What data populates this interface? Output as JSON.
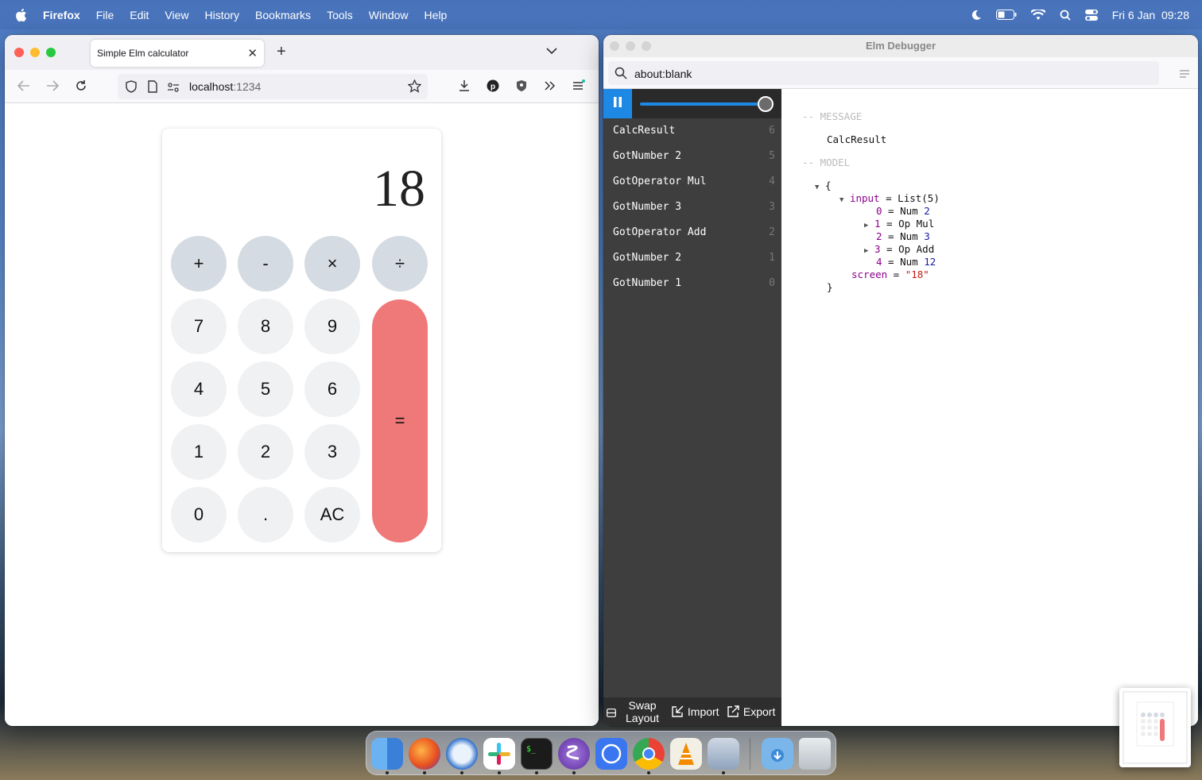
{
  "menubar": {
    "app": "Firefox",
    "items": [
      "File",
      "Edit",
      "View",
      "History",
      "Bookmarks",
      "Tools",
      "Window",
      "Help"
    ],
    "datetime": "Fri 6 Jan  09:28"
  },
  "firefox": {
    "tab_title": "Simple Elm calculator",
    "url_host": "localhost",
    "url_port": ":1234"
  },
  "calculator": {
    "screen": "18",
    "keys": {
      "add": "+",
      "sub": "-",
      "mul": "×",
      "div": "÷",
      "k7": "7",
      "k8": "8",
      "k9": "9",
      "k4": "4",
      "k5": "5",
      "k6": "6",
      "k1": "1",
      "k2": "2",
      "k3": "3",
      "k0": "0",
      "dot": ".",
      "ac": "AC",
      "eq": "="
    }
  },
  "debugger": {
    "title": "Elm Debugger",
    "url": "about:blank",
    "messages": [
      {
        "label": "CalcResult",
        "index": "6"
      },
      {
        "label": "GotNumber 2",
        "index": "5"
      },
      {
        "label": "GotOperator Mul",
        "index": "4"
      },
      {
        "label": "GotNumber 3",
        "index": "3"
      },
      {
        "label": "GotOperator Add",
        "index": "2"
      },
      {
        "label": "GotNumber 2",
        "index": "1"
      },
      {
        "label": "GotNumber 1",
        "index": "0"
      }
    ],
    "slider_fraction": 1.0,
    "message_header": "-- MESSAGE",
    "message_value": "CalcResult",
    "model_header": "-- MODEL",
    "model": {
      "open_brace": "{",
      "input_key": "input",
      "input_eq": " = ",
      "input_val": "List(5)",
      "items": [
        {
          "i": "0",
          "eq": " = ",
          "val": "Num ",
          "num": "2"
        },
        {
          "i": "1",
          "eq": " = ",
          "val": "Op Mul",
          "num": ""
        },
        {
          "i": "2",
          "eq": " = ",
          "val": "Num ",
          "num": "3"
        },
        {
          "i": "3",
          "eq": " = ",
          "val": "Op Add",
          "num": ""
        },
        {
          "i": "4",
          "eq": " = ",
          "val": "Num ",
          "num": "12"
        }
      ],
      "screen_key": "screen",
      "screen_eq": " = ",
      "screen_val": "\"18\"",
      "close_brace": "}"
    },
    "bottom": {
      "swap_line1": "Swap",
      "swap_line2": "Layout",
      "import": "Import",
      "export": "Export"
    }
  },
  "dock_apps": [
    "finder-icon",
    "firefox-icon",
    "thunderbird-icon",
    "slack-icon",
    "terminal-icon",
    "emacs-icon",
    "signal-icon",
    "chrome-icon",
    "vlc-icon",
    "preview-icon",
    "downloads-icon",
    "trash-icon"
  ]
}
